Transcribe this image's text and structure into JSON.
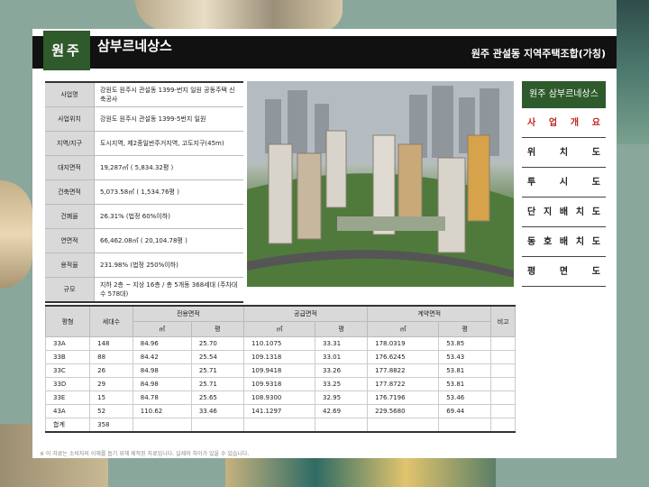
{
  "header": {
    "city": "원주",
    "title": "삼부르네상스",
    "organization": "원주 관설동 지역주택조합(가칭)"
  },
  "info": [
    {
      "label": "사업명",
      "value": "강원도 원주시 관설동 1399-번지 일원 공동주택 신축공사"
    },
    {
      "label": "사업위치",
      "value": "강원도 원주시 관설동 1399-5번지 일원"
    },
    {
      "label": "지역/지구",
      "value": "도시지역, 제2종일반주거지역, 고도지구(45m)"
    },
    {
      "label": "대지면적",
      "value": "19,287㎡ ( 5,834.32평 )"
    },
    {
      "label": "건축면적",
      "value": "5,073.58㎡ ( 1,534.76평 )"
    },
    {
      "label": "건폐율",
      "value": "26.31% (법정 60%이하)"
    },
    {
      "label": "연면적",
      "value": "66,462.08㎡ ( 20,104.78평 )"
    },
    {
      "label": "용적율",
      "value": "231.98% (법정 250%이하)"
    },
    {
      "label": "규모",
      "value": "지하 2층 ~ 지상 16층 / 총 5개동 368세대 (주차대수 578대)"
    }
  ],
  "menu": {
    "title": "원주 삼부르네상스",
    "items": [
      "사 업 개 요",
      "위 치 도",
      "투 시 도",
      "단 지 배 치 도",
      "동 호 배 치 도",
      "평 면 도"
    ],
    "active_color": "#c0261e"
  },
  "units_table": {
    "headers": {
      "type": "평형",
      "households": "세대수",
      "exclusive": "전용면적",
      "supply": "공급면적",
      "contract": "계약면적",
      "remarks": "비고",
      "sqm": "㎡",
      "pyeong": "평"
    },
    "rows": [
      {
        "type": "33A",
        "count": "148",
        "ex_m": "84.96",
        "ex_p": "25.70",
        "su_m": "110.1075",
        "su_p": "33.31",
        "co_m": "178.0319",
        "co_p": "53.85"
      },
      {
        "type": "33B",
        "count": "88",
        "ex_m": "84.42",
        "ex_p": "25.54",
        "su_m": "109.1318",
        "su_p": "33.01",
        "co_m": "176.6245",
        "co_p": "53.43"
      },
      {
        "type": "33C",
        "count": "26",
        "ex_m": "84.98",
        "ex_p": "25.71",
        "su_m": "109.9418",
        "su_p": "33.26",
        "co_m": "177.8822",
        "co_p": "53.81"
      },
      {
        "type": "33D",
        "count": "29",
        "ex_m": "84.98",
        "ex_p": "25.71",
        "su_m": "109.9318",
        "su_p": "33.25",
        "co_m": "177.8722",
        "co_p": "53.81"
      },
      {
        "type": "33E",
        "count": "15",
        "ex_m": "84.78",
        "ex_p": "25.65",
        "su_m": "108.9300",
        "su_p": "32.95",
        "co_m": "176.7196",
        "co_p": "53.46"
      },
      {
        "type": "43A",
        "count": "52",
        "ex_m": "110.62",
        "ex_p": "33.46",
        "su_m": "141.1297",
        "su_p": "42.69",
        "co_m": "229.5680",
        "co_p": "69.44"
      }
    ],
    "total_label": "합계",
    "total_count": "358"
  },
  "footnote": "※ 이 자료는 소비자의 이해를 돕기 위해 제작된 자료입니다. 실제와 차이가 있을 수 있습니다.",
  "colors": {
    "brand_green": "#2e5a2c",
    "header_bg": "#111111"
  }
}
